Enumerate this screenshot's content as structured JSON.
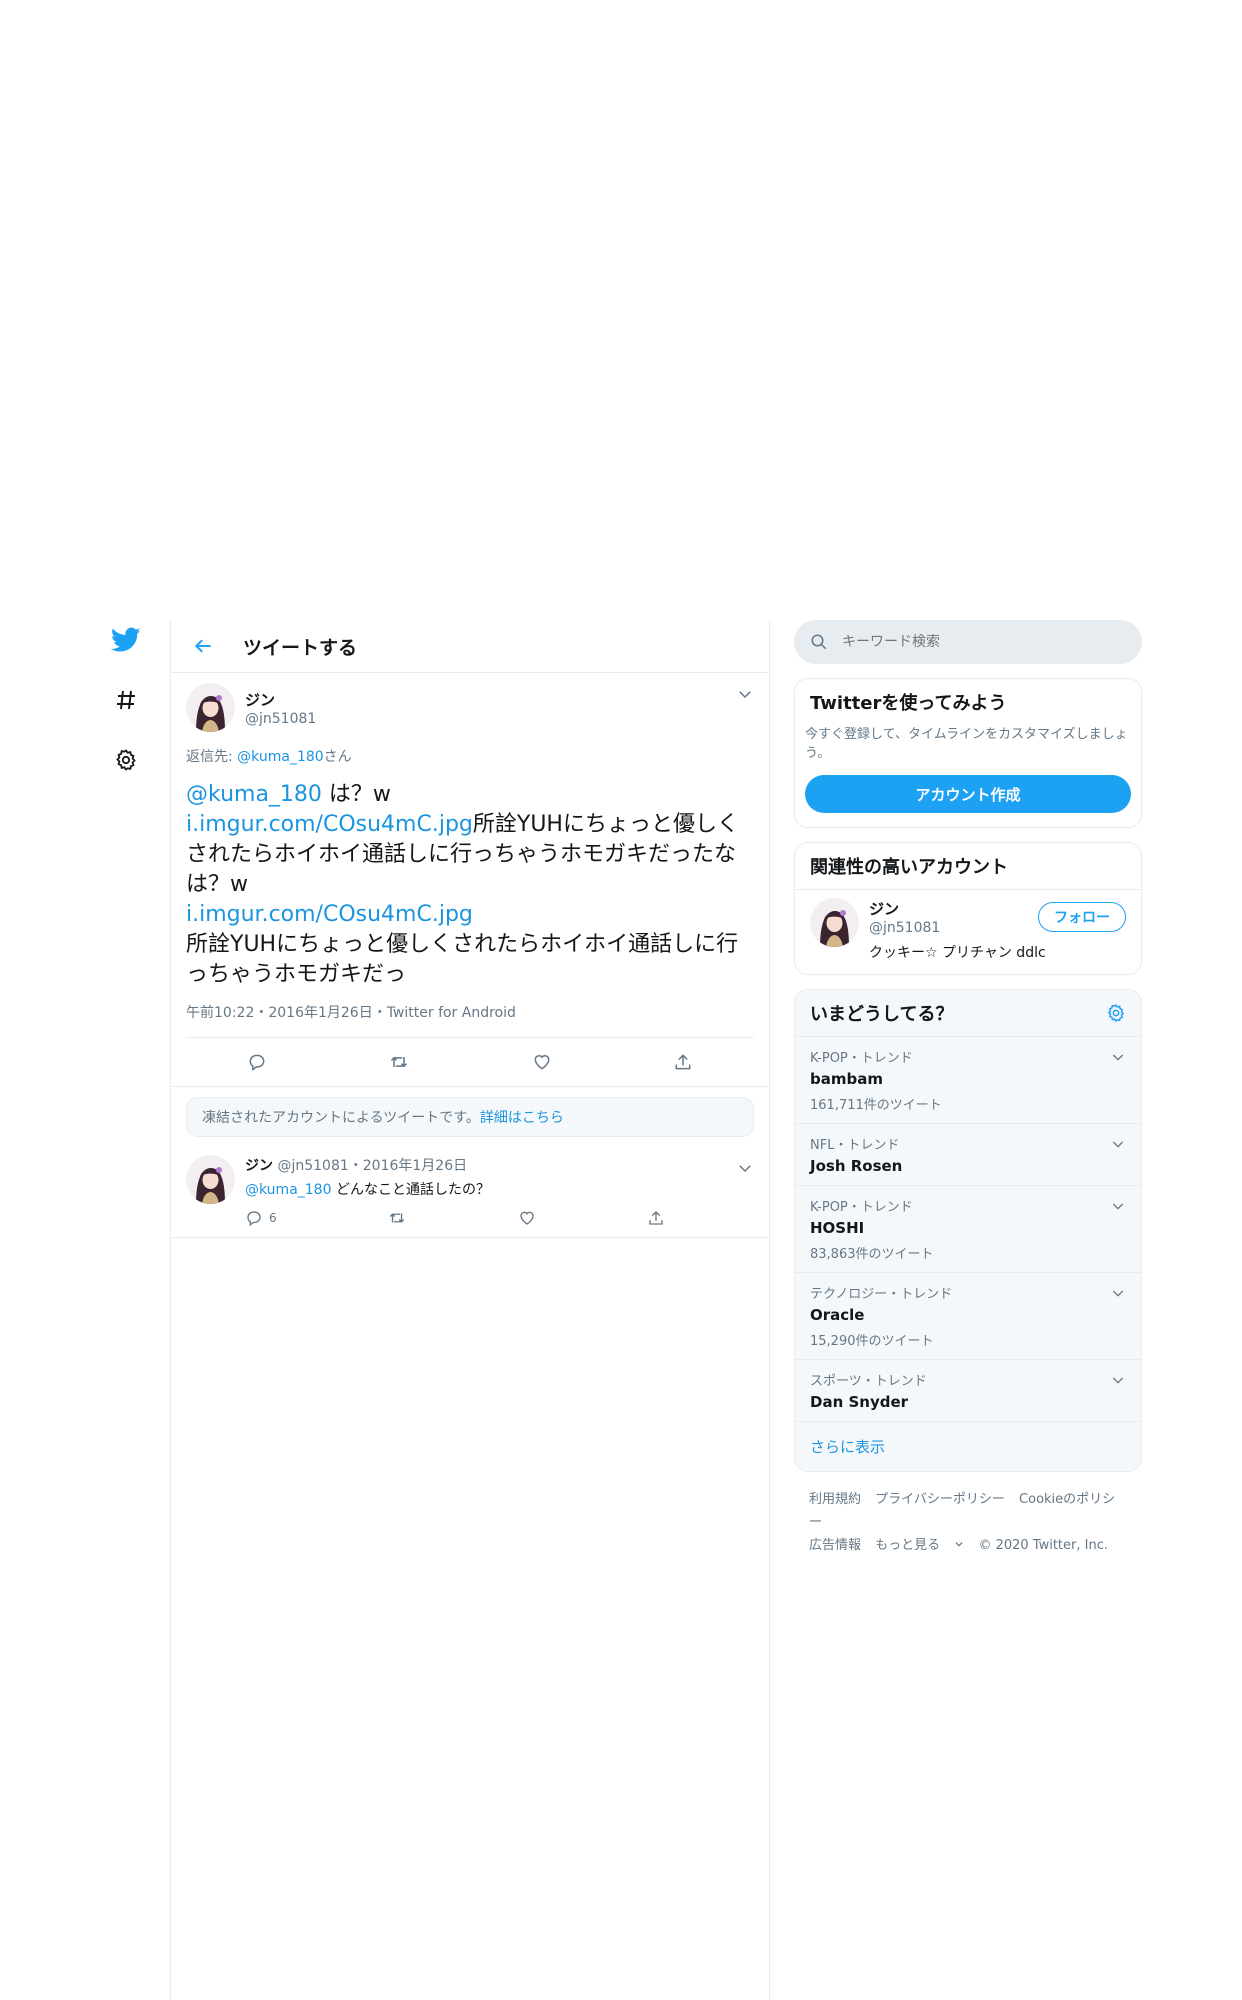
{
  "colors": {
    "accent": "#1da1f2",
    "link": "#1b95e0",
    "muted": "#657786",
    "border": "#e6ecf0"
  },
  "nav": {
    "items": [
      "twitter-logo",
      "explore-hashtag",
      "settings-gear"
    ]
  },
  "header": {
    "title": "ツイートする"
  },
  "tweet": {
    "name": "ジン",
    "handle": "@jn51081",
    "reply_label": "返信先:",
    "reply_to": "@kuma_180",
    "reply_suffix": "さん",
    "mention": "@kuma_180",
    "text1": " は？w",
    "link1": "i.imgur.com/COsu4mC.jpg",
    "text2": "所詮YUHにちょっと優しくされたらホイホイ通話しに行っちゃうホモガキだったなは？w",
    "link2": "i.imgur.com/COsu4mC.jpg",
    "text3": "所詮YUHにちょっと優しくされたらホイホイ通話しに行っちゃうホモガキだっ",
    "meta": "午前10:22・2016年1月26日・Twitter for Android"
  },
  "notice": {
    "text": "凍結されたアカウントによるツイートです。",
    "link": "詳細はこちら"
  },
  "reply": {
    "name": "ジン",
    "handle_date": "@jn51081・2016年1月26日",
    "mention": "@kuma_180",
    "text": " どんなこと通話したの？",
    "reply_count": "6"
  },
  "search": {
    "placeholder": "キーワード検索"
  },
  "signup": {
    "title": "Twitterを使ってみよう",
    "sub": "今すぐ登録して、タイムラインをカスタマイズしましょう。",
    "button": "アカウント作成"
  },
  "related": {
    "title": "関連性の高いアカウント",
    "name": "ジン",
    "handle": "@jn51081",
    "bio": "クッキー☆ プリチャン ddlc",
    "follow": "フォロー"
  },
  "trends": {
    "title": "いまどうしてる？",
    "items": [
      {
        "meta": "K-POP・トレンド",
        "name": "bambam",
        "count": "161,711件のツイート"
      },
      {
        "meta": "NFL・トレンド",
        "name": "Josh Rosen",
        "count": ""
      },
      {
        "meta": "K-POP・トレンド",
        "name": "HOSHI",
        "count": "83,863件のツイート"
      },
      {
        "meta": "テクノロジー・トレンド",
        "name": "Oracle",
        "count": "15,290件のツイート"
      },
      {
        "meta": "スポーツ・トレンド",
        "name": "Dan Snyder",
        "count": ""
      }
    ],
    "more": "さらに表示"
  },
  "footer": {
    "terms": "利用規約",
    "privacy": "プライバシーポリシー",
    "cookie": "Cookieのポリシー",
    "ads": "広告情報",
    "more": "もっと見る",
    "copyright": "© 2020 Twitter, Inc."
  }
}
